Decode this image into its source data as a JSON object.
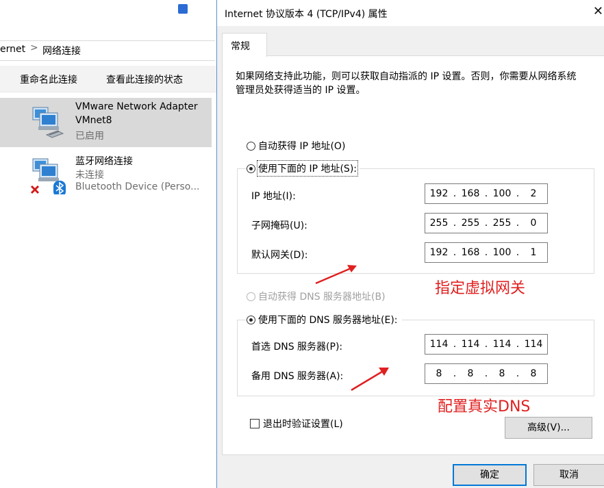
{
  "explorer": {
    "top_fragments": [
      "",
      "",
      ""
    ],
    "address": {
      "part1": "ernet",
      "separator": ">",
      "part2": "网络连接"
    },
    "commands": [
      "重命名此连接",
      "查看此连接的状态"
    ],
    "adapters": [
      {
        "name": "VMware Network Adapter",
        "name2": "VMnet8",
        "status": "已启用"
      },
      {
        "name": "蓝牙网络连接",
        "status": "未连接",
        "device": "Bluetooth Device (Perso..."
      }
    ]
  },
  "dialog": {
    "title": "Internet 协议版本 4 (TCP/IPv4) 属性",
    "close": "✕",
    "tab": "常规",
    "intro": "如果网络支持此功能，则可以获取自动指派的 IP 设置。否则，你需要从网络系统管理员处获得适当的 IP 设置。",
    "auto_ip": "自动获得 IP 地址(O)",
    "manual_ip": "使用下面的 IP 地址(S):",
    "ip_label": "IP 地址(I):",
    "subnet_label": "子网掩码(U):",
    "gateway_label": "默认网关(D):",
    "ip": [
      "192",
      "168",
      "100",
      "2"
    ],
    "subnet": [
      "255",
      "255",
      "255",
      "0"
    ],
    "gateway": [
      "192",
      "168",
      "100",
      "1"
    ],
    "auto_dns": "自动获得 DNS 服务器地址(B)",
    "manual_dns": "使用下面的 DNS 服务器地址(E):",
    "preferred_label": "首选 DNS 服务器(P):",
    "alternate_label": "备用 DNS 服务器(A):",
    "preferred": [
      "114",
      "114",
      "114",
      "114"
    ],
    "alternate": [
      "8",
      "8",
      "8",
      "8"
    ],
    "validate": "退出时验证设置(L)",
    "advanced": "高级(V)...",
    "ok": "确定",
    "cancel": "取消"
  },
  "annotations": {
    "gateway_note": "指定虚拟网关",
    "dns_note": "配置真实DNS",
    "color": "#e02020"
  },
  "colors": {
    "accent": "#0078d7",
    "selection": "#d9d9d9"
  }
}
